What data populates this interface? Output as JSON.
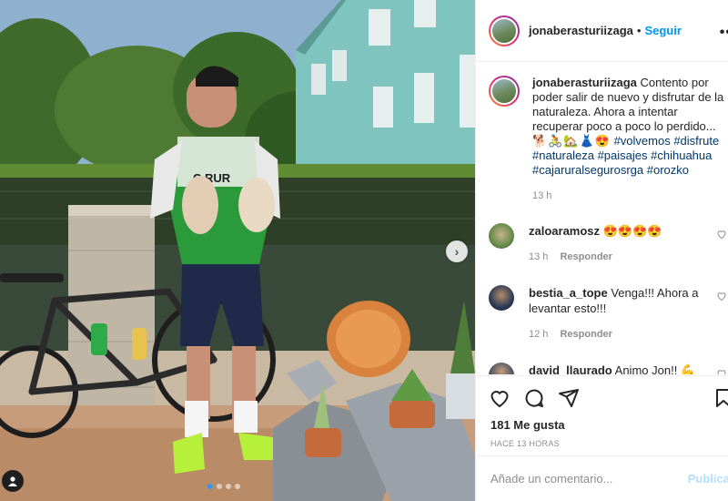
{
  "post": {
    "author": "jonaberasturiizaga",
    "separator": "•",
    "follow_label": "Seguir",
    "more_icon": "more-horizontal-icon",
    "caption": {
      "username": "jonaberasturiizaga",
      "text": "Contento por poder salir de nuevo y disfrutar de la naturaleza. Ahora a intentar recuperar poco a poco lo perdido...",
      "emojis": "🐕🚴🏡👗😍",
      "hashtags": [
        "#volvemos",
        "#disfrute",
        "#naturaleza",
        "#paisajes",
        "#chihuahua",
        "#cajaruralsegurosrga",
        "#orozko"
      ],
      "time": "13 h"
    },
    "comments": [
      {
        "username": "zaloaramosz",
        "text": "😍😍😍😍",
        "time": "13 h",
        "reply_label": "Responder"
      },
      {
        "username": "bestia_a_tope",
        "text": "Venga!!! Ahora a levantar esto!!!",
        "time": "12 h",
        "reply_label": "Responder"
      },
      {
        "username": "david_llaurado",
        "text": "Animo Jon!! 💪",
        "time": "",
        "reply_label": ""
      }
    ],
    "likes": "181 Me gusta",
    "posted_ago": "HACE 13 HORAS",
    "comment_placeholder": "Añade un comentario...",
    "publish_label": "Publicar"
  },
  "colors": {
    "link_blue": "#0095f6",
    "hashtag": "#00376b",
    "muted": "#8e8e8e",
    "publish_disabled": "#b2dffc"
  }
}
